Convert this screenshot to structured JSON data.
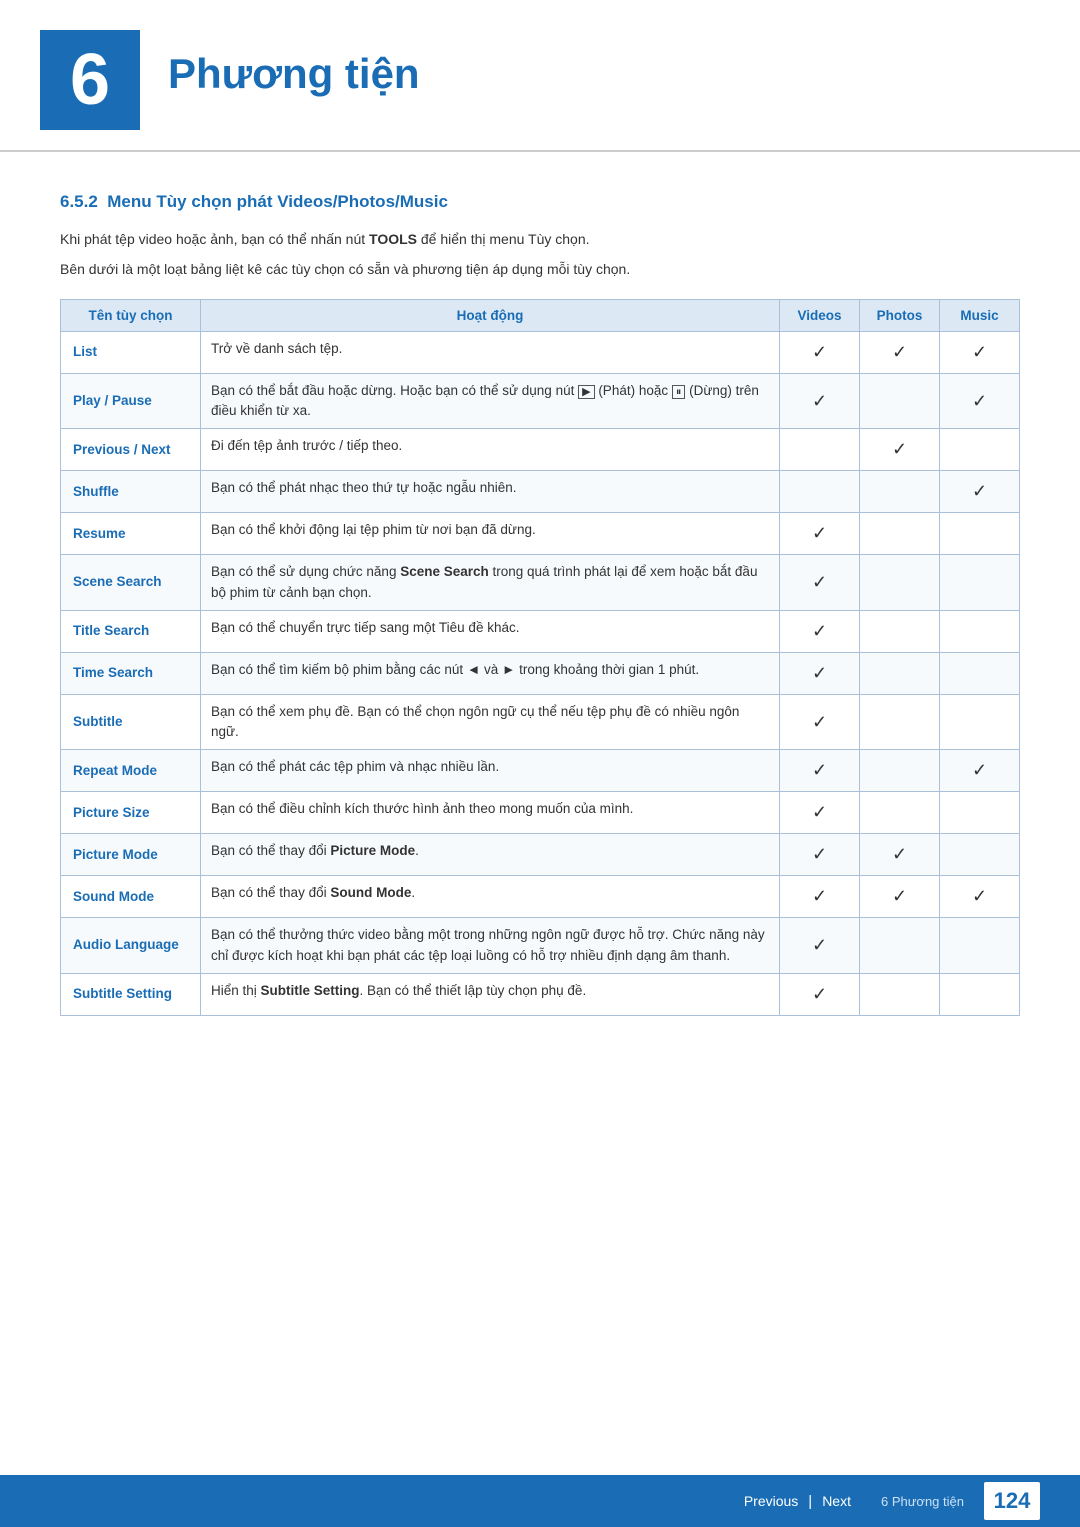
{
  "header": {
    "chapter_number": "6",
    "chapter_title": "Phương tiện"
  },
  "section": {
    "number": "6.5.2",
    "title": "Menu Tùy chọn phát Videos/Photos/Music"
  },
  "intro": {
    "line1": "Khi phát tệp video hoặc ảnh, bạn có thể nhấn nút TOOLS để hiển thị menu Tùy chọn.",
    "line1_bold": "TOOLS",
    "line2": "Bên dưới là một loạt bảng liệt kê các tùy chọn có sẵn và phương tiện áp dụng mỗi tùy chọn."
  },
  "table": {
    "headers": {
      "name": "Tên tùy chọn",
      "action": "Hoạt động",
      "videos": "Videos",
      "photos": "Photos",
      "music": "Music"
    },
    "rows": [
      {
        "name": "List",
        "action": "Trở về danh sách tệp.",
        "videos": true,
        "photos": true,
        "music": true
      },
      {
        "name": "Play / Pause",
        "action": "Bạn có thể bắt đầu hoặc dừng. Hoặc bạn có thể sử dụng nút ▶ (Phát) hoặc ⏸ (Dừng) trên điều khiển từ xa.",
        "videos": true,
        "photos": false,
        "music": true
      },
      {
        "name": "Previous / Next",
        "action": "Đi đến tệp ảnh trước / tiếp theo.",
        "videos": false,
        "photos": true,
        "music": false
      },
      {
        "name": "Shuffle",
        "action": "Bạn có thể phát nhạc theo thứ tự hoặc ngẫu nhiên.",
        "videos": false,
        "photos": false,
        "music": true
      },
      {
        "name": "Resume",
        "action": "Bạn có thể khởi động lại tệp phim từ nơi bạn đã dừng.",
        "videos": true,
        "photos": false,
        "music": false
      },
      {
        "name": "Scene Search",
        "action": "Bạn có thể sử dụng chức năng Scene Search trong quá trình phát lại để xem hoặc bắt đầu bộ phim từ cảnh bạn chọn.",
        "action_bold": "Scene Search",
        "videos": true,
        "photos": false,
        "music": false
      },
      {
        "name": "Title Search",
        "action": "Bạn có thể chuyển trực tiếp sang một Tiêu đề khác.",
        "videos": true,
        "photos": false,
        "music": false
      },
      {
        "name": "Time Search",
        "action": "Bạn có thể tìm kiếm bộ phim bằng các nút ◄ và ► trong khoảng thời gian 1 phút.",
        "videos": true,
        "photos": false,
        "music": false
      },
      {
        "name": "Subtitle",
        "action": "Bạn có thể xem phụ đề. Bạn có thể chọn ngôn ngữ cụ thể nếu tệp phụ đề có nhiều ngôn ngữ.",
        "videos": true,
        "photos": false,
        "music": false
      },
      {
        "name": "Repeat Mode",
        "action": "Bạn có thể phát các tệp phim và nhạc nhiều lần.",
        "videos": true,
        "photos": false,
        "music": true
      },
      {
        "name": "Picture Size",
        "action": "Bạn có thể điều chỉnh kích thước hình ảnh theo mong muốn của mình.",
        "videos": true,
        "photos": false,
        "music": false
      },
      {
        "name": "Picture Mode",
        "action": "Bạn có thể thay đổi Picture Mode.",
        "action_bold": "Picture Mode",
        "videos": true,
        "photos": true,
        "music": false
      },
      {
        "name": "Sound Mode",
        "action": "Bạn có thể thay đổi Sound Mode.",
        "action_bold": "Sound Mode",
        "videos": true,
        "photos": true,
        "music": true
      },
      {
        "name": "Audio Language",
        "action": "Bạn có thể thưởng thức video bằng một trong những ngôn ngữ được hỗ trợ. Chức năng này chỉ được kích hoạt khi bạn phát các tệp loại luồng có hỗ trợ nhiều định dạng âm thanh.",
        "videos": true,
        "photos": false,
        "music": false
      },
      {
        "name": "Subtitle Setting",
        "action": "Hiển thị Subtitle Setting. Bạn có thể thiết lập tùy chọn phụ đề.",
        "action_bold": "Subtitle Setting",
        "videos": true,
        "photos": false,
        "music": false
      }
    ]
  },
  "footer": {
    "prev_label": "Previous",
    "next_label": "Next",
    "chapter_label": "6 Phương tiện",
    "page_number": "124"
  }
}
